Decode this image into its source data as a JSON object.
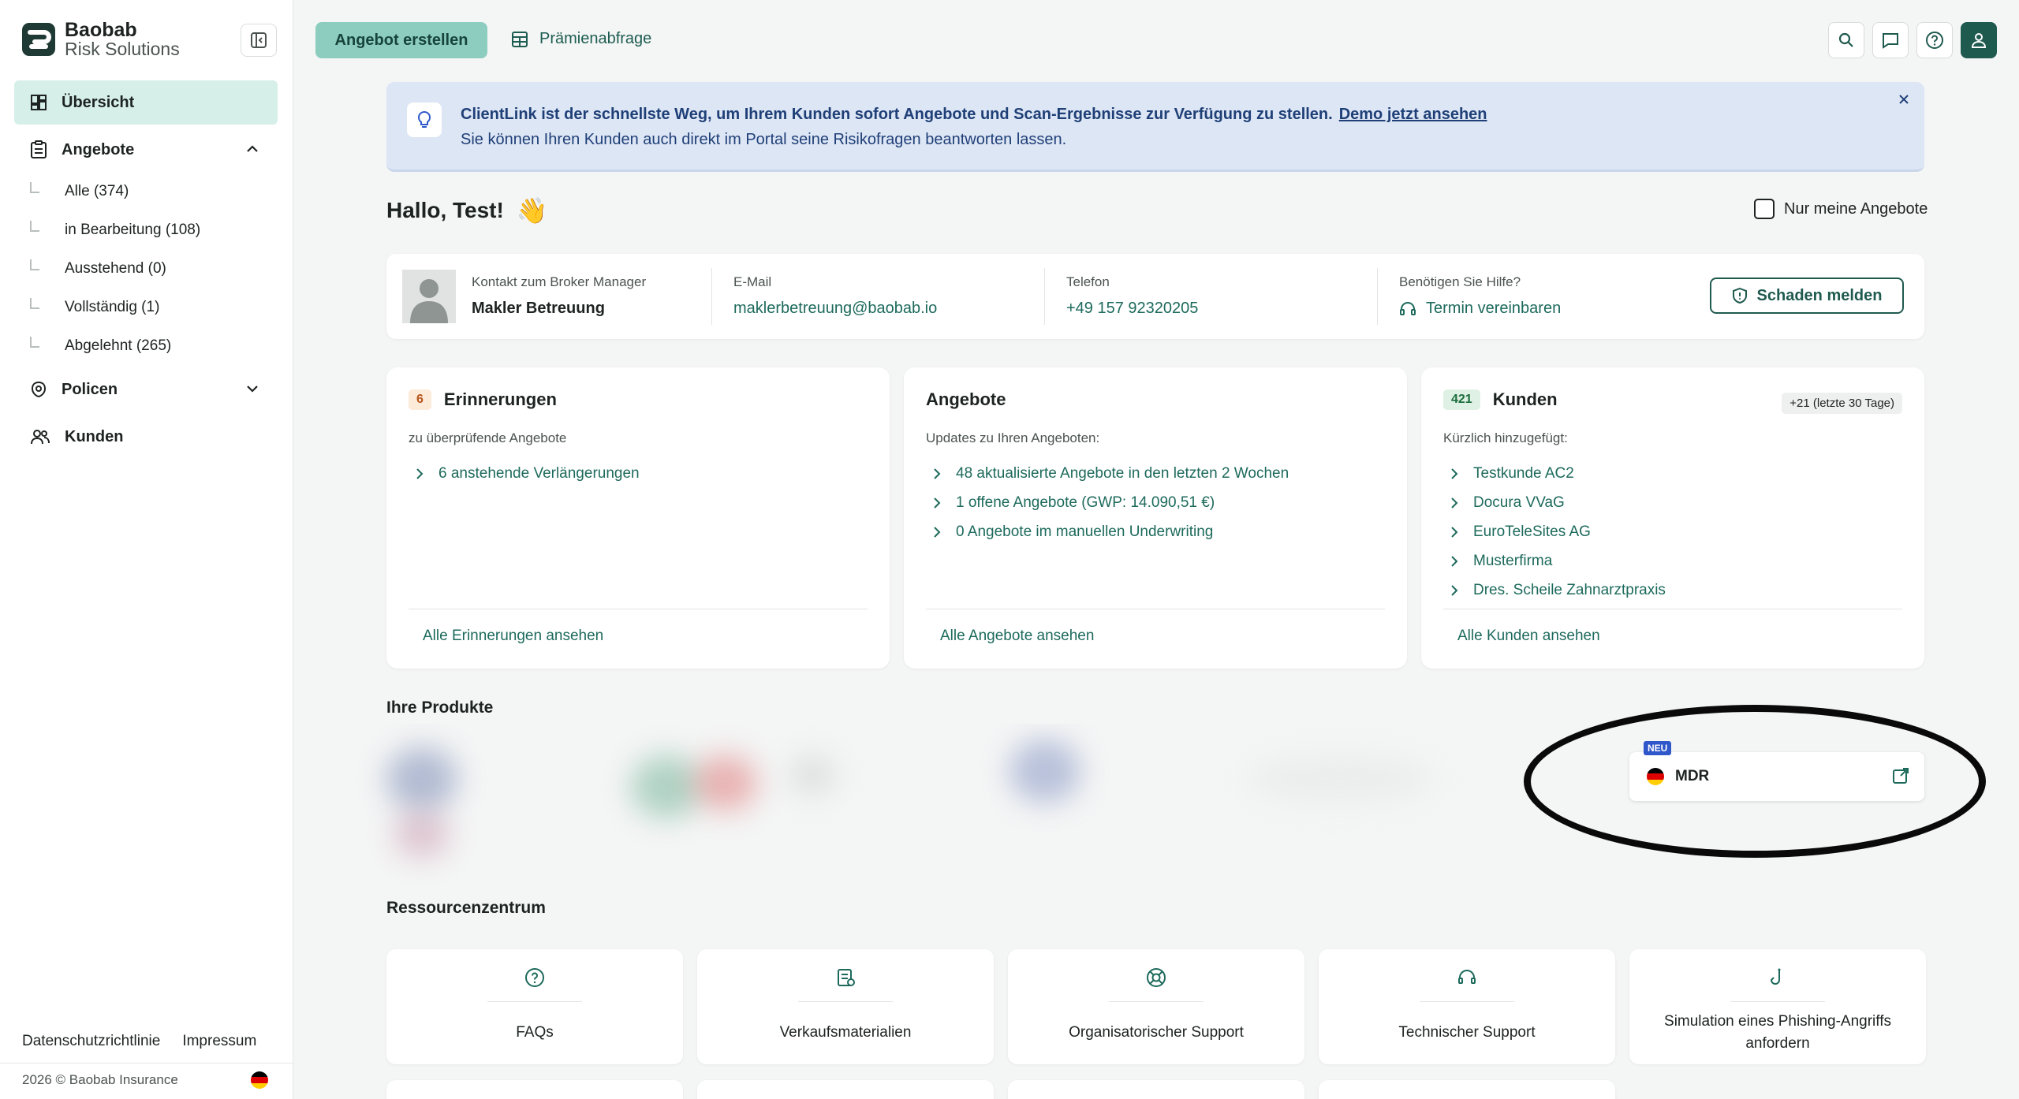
{
  "sidebar": {
    "logo": {
      "name": "Baobab",
      "sub": "Risk Solutions"
    },
    "nav": {
      "overview": "Übersicht",
      "offers": "Angebote",
      "policies": "Policen",
      "customers": "Kunden"
    },
    "offer_filters": [
      "Alle (374)",
      "in Bearbeitung (108)",
      "Ausstehend (0)",
      "Vollständig (1)",
      "Abgelehnt (265)"
    ],
    "footer": {
      "privacy": "Datenschutzrichtlinie",
      "imprint": "Impressum",
      "copyright": "2026 © Baobab Insurance"
    }
  },
  "topbar": {
    "create_offer": "Angebot erstellen",
    "premium_query": "Prämienabfrage"
  },
  "banner": {
    "headline": "ClientLink ist der schnellste Weg, um Ihrem Kunden sofort Angebote und Scan-Ergebnisse zur Verfügung zu stellen.",
    "link": "Demo jetzt ansehen",
    "subline": "Sie können Ihren Kunden auch direkt im Portal seine Risikofragen beantworten lassen."
  },
  "greeting": {
    "text": "Hallo, Test!",
    "emoji": "👋"
  },
  "only_mine": "Nur meine Angebote",
  "contact": {
    "manager_label": "Kontakt zum Broker Manager",
    "manager_value": "Makler Betreuung",
    "email_label": "E-Mail",
    "email_value": "maklerbetreuung@baobab.io",
    "phone_label": "Telefon",
    "phone_value": "+49 157 92320205",
    "help_label": "Benötigen Sie Hilfe?",
    "help_value": "Termin vereinbaren",
    "report_damage": "Schaden melden"
  },
  "cards": {
    "reminders": {
      "count": "6",
      "title": "Erinnerungen",
      "subtitle": "zu überprüfende Angebote",
      "items": [
        "6 anstehende Verlängerungen"
      ],
      "footer": "Alle Erinnerungen ansehen"
    },
    "offers": {
      "title": "Angebote",
      "subtitle": "Updates zu Ihren Angeboten:",
      "items": [
        "48 aktualisierte Angebote in den letzten 2 Wochen",
        "1 offene Angebote (GWP: 14.090,51 €)",
        "0 Angebote im manuellen Underwriting"
      ],
      "footer": "Alle Angebote ansehen"
    },
    "customers": {
      "count": "421",
      "title": "Kunden",
      "badge": "+21 (letzte 30 Tage)",
      "subtitle": "Kürzlich hinzugefügt:",
      "items": [
        "Testkunde AC2",
        "Docura VVaG",
        "EuroTeleSites AG",
        "Musterfirma",
        "Dres. Scheile Zahnarztpraxis"
      ],
      "footer": "Alle Kunden ansehen"
    }
  },
  "products": {
    "title": "Ihre Produkte",
    "new_badge": "NEU",
    "product_name": "MDR"
  },
  "resources": {
    "title": "Ressourcenzentrum",
    "items": [
      "FAQs",
      "Verkaufsmaterialien",
      "Organisatorischer Support",
      "Technischer Support",
      "Simulation eines Phishing-Angriffs anfordern"
    ]
  },
  "colors": {
    "accent": "#1f5a4f",
    "accent_light": "#8ccdbf",
    "link": "#1d6a5c",
    "active_nav_bg": "#d6efe9",
    "banner_bg": "#dde6f5"
  }
}
